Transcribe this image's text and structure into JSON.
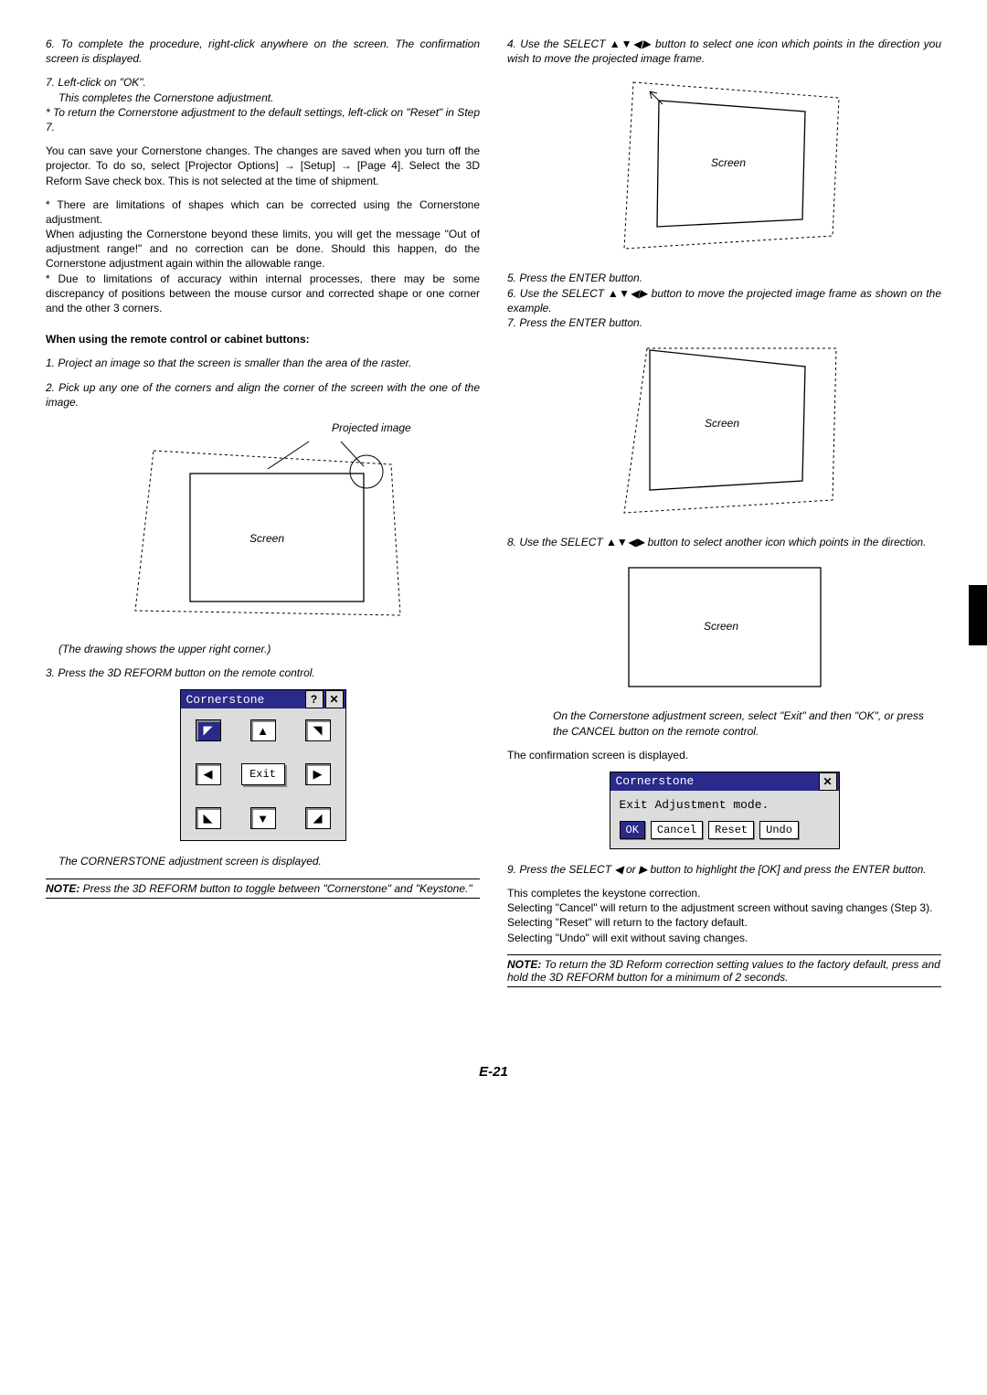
{
  "left": {
    "p6": "6. To complete the procedure, right-click anywhere on the screen. The confirmation screen is displayed.",
    "p7a": "7. Left-click on \"OK\".",
    "p7b": "This completes the Cornerstone adjustment.",
    "p7c": "* To return the Cornerstone adjustment to the default settings, left-click on \"Reset\" in Step 7.",
    "save": "You can save your Cornerstone changes. The changes are saved when you turn off the projector. To do so, select [Projector Options] → [Setup] → [Page 4]. Select the 3D Reform Save check box. This is not selected at the time of shipment.",
    "lim1": "* There are limitations of shapes which can be corrected using the Cornerstone adjustment.",
    "lim2": "When adjusting the Cornerstone beyond these limits, you will get the message \"Out of adjustment range!\" and no correction can be done. Should this happen, do the Cornerstone adjustment again within the allowable range.",
    "lim3": "* Due to limitations of accuracy within internal processes, there may be some discrepancy of positions between the mouse cursor and corrected shape or one corner and the other 3 corners.",
    "remoteHdr": "When using the remote control or cabinet buttons:",
    "r1": "1. Project an image so that the screen is smaller than the area of the raster.",
    "r2": "2. Pick up any one of the corners and align the corner of the screen with the one of the image.",
    "projLbl": "Projected image",
    "screenLbl": "Screen",
    "drawNote": "(The drawing shows the upper right corner.)",
    "r3": "3. Press the 3D REFORM button on the remote control.",
    "osd": {
      "title": "Cornerstone",
      "help": "?",
      "close": "✕",
      "tl": "◤",
      "t": "▲",
      "tr": "◥",
      "l": "◀",
      "exit": "Exit",
      "r": "▶",
      "bl": "◣",
      "b": "▼",
      "br": "◢"
    },
    "osdDisp": "The CORNERSTONE adjustment screen is displayed.",
    "note1Label": "NOTE:",
    "note1": " Press the 3D REFORM button to toggle between \"Cornerstone\" and \"Keystone.\""
  },
  "right": {
    "p4": "4. Use the SELECT ▲▼◀▶ button to select one icon which points in the direction you wish to move the projected image frame.",
    "screenLbl": "Screen",
    "p5": "5. Press the ENTER button.",
    "p6": "6. Use the SELECT ▲▼◀▶ button to move the projected image frame as shown on the example.",
    "p7": "7. Press the ENTER button.",
    "p8": "8. Use the SELECT ▲▼◀▶ button to select another icon which points in the direction.",
    "exitAdvice": "On the Cornerstone adjustment screen, select \"Exit\" and then \"OK\", or press the CANCEL button on the remote control.",
    "conf": "The confirmation screen is displayed.",
    "osd2": {
      "title": "Cornerstone",
      "close": "✕",
      "msg": "Exit Adjustment mode.",
      "ok": "OK",
      "cancel": "Cancel",
      "reset": "Reset",
      "undo": "Undo"
    },
    "p9": "9. Press the SELECT ◀ or ▶ button to highlight the [OK] and press the ENTER button.",
    "done": "This completes the keystone correction.",
    "selCancel": "Selecting \"Cancel\" will return to the adjustment screen without saving changes (Step 3).",
    "selReset": "Selecting \"Reset\" will return to the factory default.",
    "selUndo": "Selecting \"Undo\" will exit without saving changes.",
    "note2Label": "NOTE:",
    "note2": " To return the 3D Reform correction setting values to the factory default, press and hold the 3D REFORM button for a minimum of 2 seconds."
  },
  "page": "E-21"
}
